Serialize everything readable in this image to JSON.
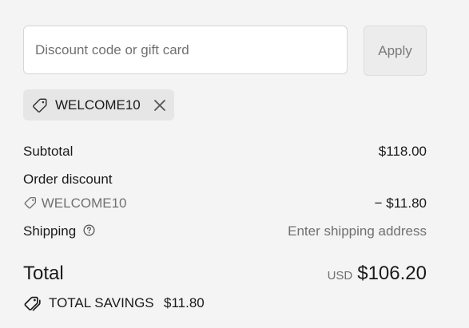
{
  "discount": {
    "input_placeholder": "Discount code or gift card",
    "input_value": "",
    "apply_label": "Apply",
    "applied_code": "WELCOME10"
  },
  "summary": {
    "subtotal_label": "Subtotal",
    "subtotal_value": "$118.00",
    "order_discount_label": "Order discount",
    "discount_code": "WELCOME10",
    "discount_value": "− $11.80",
    "shipping_label": "Shipping",
    "shipping_value": "Enter shipping address"
  },
  "total": {
    "label": "Total",
    "currency": "USD",
    "amount": "$106.20"
  },
  "savings": {
    "label": "TOTAL SAVINGS",
    "value": "$11.80"
  },
  "icons": {
    "chip_tag": "tag-icon",
    "chip_remove": "close-icon",
    "discount_line_tag": "tag-icon",
    "shipping_help": "question-circle-icon",
    "savings": "double-tag-icon"
  }
}
